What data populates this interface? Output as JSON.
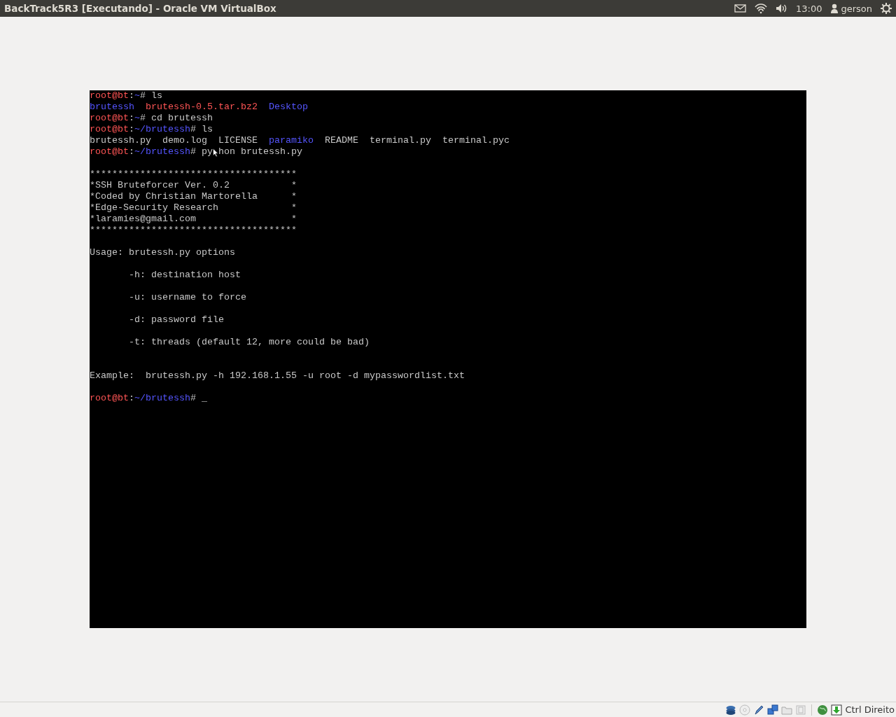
{
  "window": {
    "title": "BackTrack5R3 [Executando] - Oracle VM VirtualBox"
  },
  "top_panel": {
    "clock": "13:00",
    "user": "gerson"
  },
  "terminal": {
    "lines": [
      {
        "kind": "text",
        "segments": [
          {
            "kind": "user",
            "text": "root@bt"
          },
          {
            "kind": "plain",
            "text": ":"
          },
          {
            "kind": "path",
            "text": "~"
          },
          {
            "kind": "plain",
            "text": "# ls"
          }
        ]
      },
      {
        "kind": "listing",
        "segments": [
          {
            "kind": "dir",
            "text": "brutessh"
          },
          {
            "kind": "archive",
            "text": "brutessh-0.5.tar.bz2"
          },
          {
            "kind": "dir",
            "text": "Desktop"
          }
        ]
      },
      {
        "kind": "text",
        "segments": [
          {
            "kind": "user",
            "text": "root@bt"
          },
          {
            "kind": "plain",
            "text": ":"
          },
          {
            "kind": "path",
            "text": "~"
          },
          {
            "kind": "plain",
            "text": "# cd brutessh"
          }
        ]
      },
      {
        "kind": "text",
        "segments": [
          {
            "kind": "user",
            "text": "root@bt"
          },
          {
            "kind": "plain",
            "text": ":"
          },
          {
            "kind": "path",
            "text": "~/brutessh"
          },
          {
            "kind": "plain",
            "text": "# ls"
          }
        ]
      },
      {
        "kind": "listing",
        "segments": [
          {
            "kind": "plain",
            "text": "brutessh.py"
          },
          {
            "kind": "plain",
            "text": "demo.log"
          },
          {
            "kind": "plain",
            "text": "LICENSE"
          },
          {
            "kind": "dir",
            "text": "paramiko"
          },
          {
            "kind": "plain",
            "text": "README"
          },
          {
            "kind": "plain",
            "text": "terminal.py"
          },
          {
            "kind": "plain",
            "text": "terminal.pyc"
          }
        ]
      },
      {
        "kind": "text",
        "segments": [
          {
            "kind": "user",
            "text": "root@bt"
          },
          {
            "kind": "plain",
            "text": ":"
          },
          {
            "kind": "path",
            "text": "~/brutessh"
          },
          {
            "kind": "plain",
            "text": "# py"
          },
          {
            "kind": "pointer"
          },
          {
            "kind": "plain",
            "text": "hon brutessh.py"
          }
        ]
      },
      {
        "kind": "blank"
      },
      {
        "kind": "text",
        "segments": [
          {
            "kind": "plain",
            "text": "*************************************"
          }
        ]
      },
      {
        "kind": "text",
        "segments": [
          {
            "kind": "plain",
            "text": "*SSH Bruteforcer Ver. 0.2           *"
          }
        ]
      },
      {
        "kind": "text",
        "segments": [
          {
            "kind": "plain",
            "text": "*Coded by Christian Martorella      *"
          }
        ]
      },
      {
        "kind": "text",
        "segments": [
          {
            "kind": "plain",
            "text": "*Edge-Security Research             *"
          }
        ]
      },
      {
        "kind": "text",
        "segments": [
          {
            "kind": "plain",
            "text": "*laramies@gmail.com                 *"
          }
        ]
      },
      {
        "kind": "text",
        "segments": [
          {
            "kind": "plain",
            "text": "*************************************"
          }
        ]
      },
      {
        "kind": "blank"
      },
      {
        "kind": "text",
        "segments": [
          {
            "kind": "plain",
            "text": "Usage: brutessh.py options"
          }
        ]
      },
      {
        "kind": "blank"
      },
      {
        "kind": "text",
        "segments": [
          {
            "kind": "plain",
            "text": "       -h: destination host"
          }
        ]
      },
      {
        "kind": "blank"
      },
      {
        "kind": "text",
        "segments": [
          {
            "kind": "plain",
            "text": "       -u: username to force"
          }
        ]
      },
      {
        "kind": "blank"
      },
      {
        "kind": "text",
        "segments": [
          {
            "kind": "plain",
            "text": "       -d: password file"
          }
        ]
      },
      {
        "kind": "blank"
      },
      {
        "kind": "text",
        "segments": [
          {
            "kind": "plain",
            "text": "       -t: threads (default 12, more could be bad)"
          }
        ]
      },
      {
        "kind": "blank"
      },
      {
        "kind": "blank"
      },
      {
        "kind": "text",
        "segments": [
          {
            "kind": "plain",
            "text": "Example:  brutessh.py -h 192.168.1.55 -u root -d mypasswordlist.txt"
          }
        ]
      },
      {
        "kind": "blank"
      },
      {
        "kind": "text",
        "segments": [
          {
            "kind": "user",
            "text": "root@bt"
          },
          {
            "kind": "plain",
            "text": ":"
          },
          {
            "kind": "path",
            "text": "~/brutessh"
          },
          {
            "kind": "plain",
            "text": "# "
          },
          {
            "kind": "cursor",
            "text": "_"
          }
        ]
      }
    ]
  },
  "status_bar": {
    "host_key": "Ctrl Direito"
  }
}
